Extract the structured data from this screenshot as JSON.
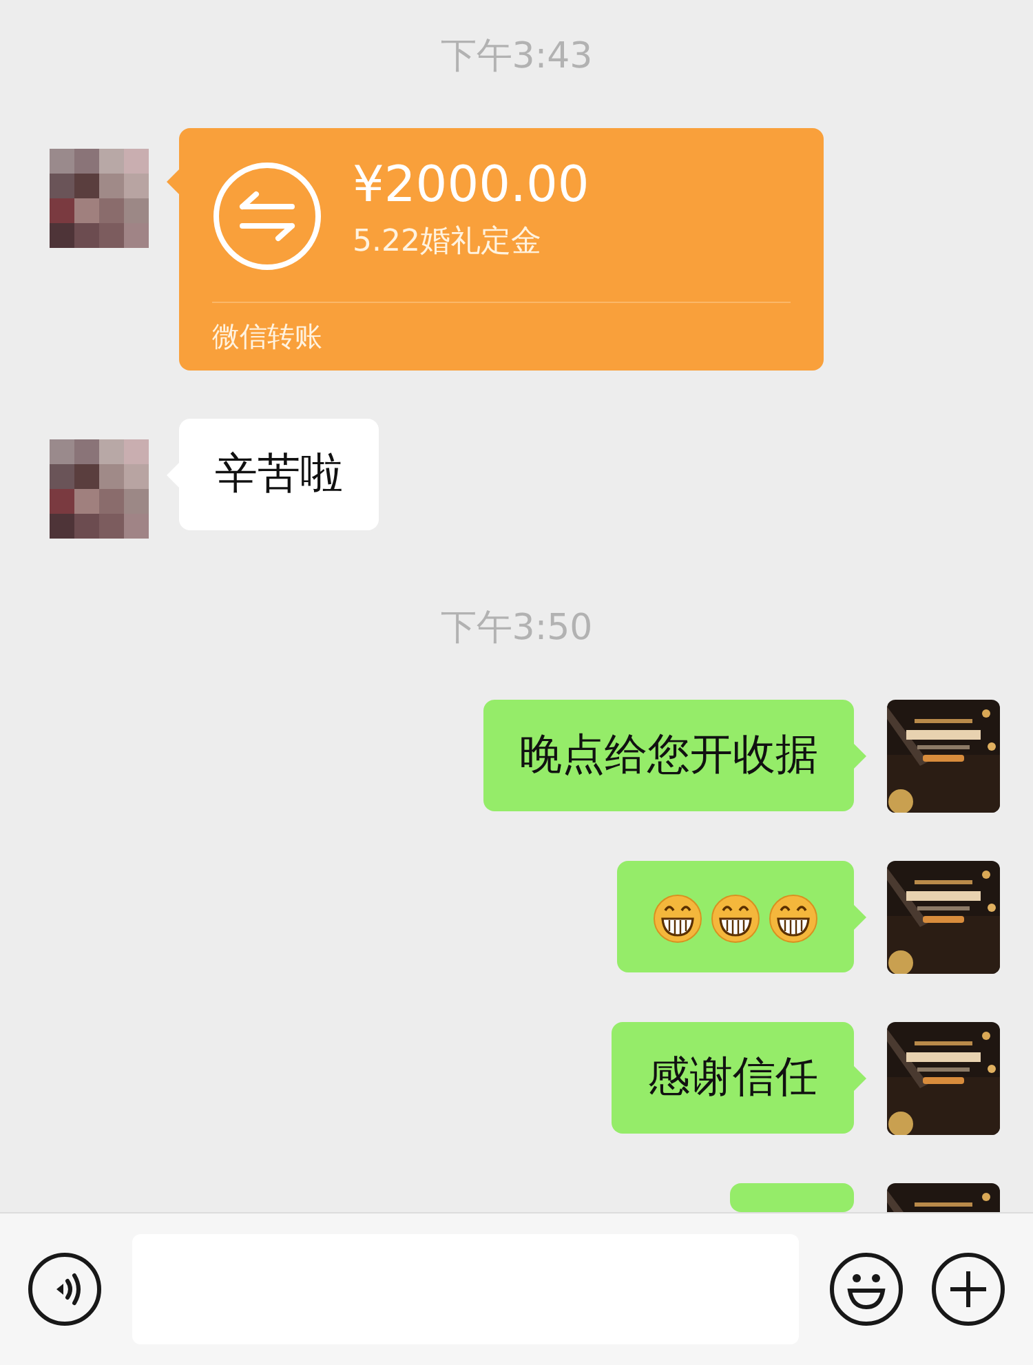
{
  "messages": [
    {
      "kind": "time",
      "text": "下午3:43"
    },
    {
      "kind": "transfer",
      "outgoing": false,
      "amount": "¥2000.00",
      "note": "5.22婚礼定金",
      "footer": "微信转账"
    },
    {
      "kind": "text",
      "outgoing": false,
      "text": "辛苦啦"
    },
    {
      "kind": "time",
      "text": "下午3:50"
    },
    {
      "kind": "text",
      "outgoing": true,
      "text": "晚点给您开收据"
    },
    {
      "kind": "emoji",
      "outgoing": true,
      "items": [
        {
          "kind": "grin"
        },
        {
          "kind": "grin"
        },
        {
          "kind": "grin"
        }
      ]
    },
    {
      "kind": "text",
      "outgoing": true,
      "text": "感谢信任"
    },
    {
      "kind": "cut",
      "outgoing": true
    }
  ]
}
